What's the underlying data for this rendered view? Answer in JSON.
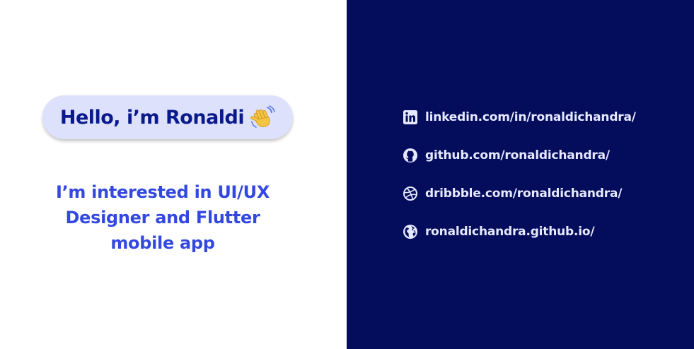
{
  "colors": {
    "left_background": "#ffffff",
    "right_background": "#040C5C",
    "pill_background": "#DDE1FB",
    "greeting_text": "#0A1A8C",
    "tagline_text": "#3348E0",
    "link_text": "#E6E9FF"
  },
  "greeting": {
    "text": "Hello, i’m Ronaldi",
    "icon": "waving-hand-icon"
  },
  "tagline": {
    "lines": [
      "I’m interested in UI/UX",
      "Designer and Flutter",
      "mobile app"
    ]
  },
  "links": [
    {
      "icon": "linkedin-icon",
      "text": "linkedin.com/in/ronaldichandra/"
    },
    {
      "icon": "github-icon",
      "text": "github.com/ronaldichandra/"
    },
    {
      "icon": "dribbble-icon",
      "text": "dribbble.com/ronaldichandra/"
    },
    {
      "icon": "globe-icon",
      "text": "ronaldichandra.github.io/"
    }
  ]
}
